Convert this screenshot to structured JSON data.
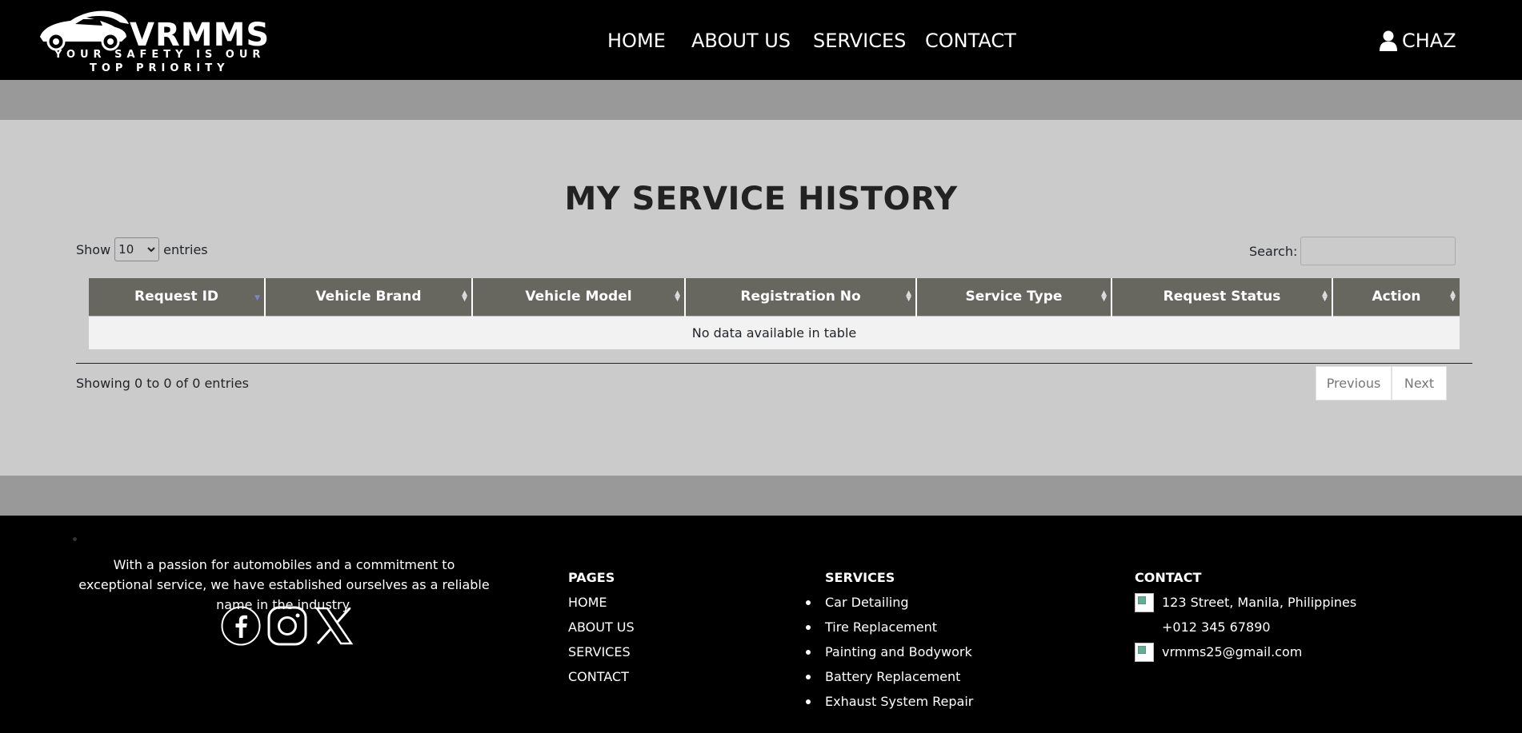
{
  "header": {
    "logo_text": "VRMMS",
    "logo_tagline_1": "YOUR SAFETY IS OUR",
    "logo_tagline_2": "TOP PRIORITY",
    "nav": [
      "HOME",
      "ABOUT US",
      "SERVICES",
      "CONTACT"
    ],
    "user_name": "CHAZ"
  },
  "main": {
    "title": "MY SERVICE HISTORY",
    "length": {
      "show_label": "Show",
      "selected": "10",
      "entries_label": "entries"
    },
    "search_label": "Search:",
    "columns": [
      "Request ID",
      "Vehicle Brand",
      "Vehicle Model",
      "Registration No",
      "Service Type",
      "Request Status",
      "Action"
    ],
    "empty_message": "No data available in table",
    "info": "Showing 0 to 0 of 0 entries",
    "pagination": {
      "previous": "Previous",
      "next": "Next"
    }
  },
  "footer": {
    "about": "With a passion for automobiles and a commitment to exceptional service, we have established ourselves as a reliable name in the industry.",
    "social_icons": [
      "facebook-icon",
      "instagram-icon",
      "x-icon"
    ],
    "pages_heading": "PAGES",
    "pages": [
      "HOME",
      "ABOUT US",
      "SERVICES",
      "CONTACT"
    ],
    "services_heading": "SERVICES",
    "services": [
      "Car Detailing",
      "Tire Replacement",
      "Painting and Bodywork",
      "Battery Replacement",
      "Exhaust System Repair"
    ],
    "contact_heading": "CONTACT",
    "address": "123 Street, Manila, Philippines",
    "phone": "+012 345 67890",
    "email": "vrmms25@gmail.com"
  },
  "colors": {
    "header_bg": "#000000",
    "band": "#999999",
    "page_bg": "#cbcbcb",
    "table_header": "#67665f",
    "sort_active": "#7a86c8"
  }
}
